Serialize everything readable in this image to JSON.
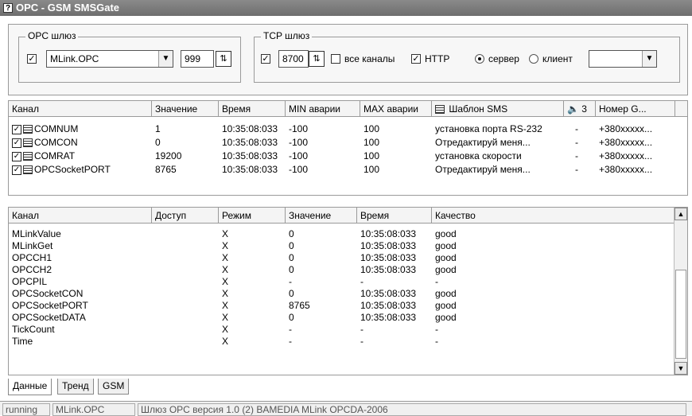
{
  "window": {
    "title": "OPC - GSM SMSGate",
    "title_icon": "?"
  },
  "opc_group": {
    "legend": "OPC шлюз",
    "server_value": "MLink.OPC",
    "port_value": "999"
  },
  "tcp_group": {
    "legend": "TCP шлюз",
    "port_value": "8700",
    "all_channels_label": "все каналы",
    "http_label": "HTTP",
    "server_label": "сервер",
    "client_label": "клиент",
    "mode_select_value": ""
  },
  "channels_table": {
    "columns": [
      "Канал",
      "Значение",
      "Время",
      "MIN аварии",
      "MAX аварии",
      "Шаблон SMS",
      "3",
      "Номер G..."
    ],
    "rows": [
      {
        "channel": "COMNUM",
        "value": "1",
        "time": "10:35:08:033",
        "min": "-100",
        "max": "100",
        "sms": "установка порта RS-232",
        "flag": "-",
        "phone": "+380xxxxx..."
      },
      {
        "channel": "COMCON",
        "value": "0",
        "time": "10:35:08:033",
        "min": "-100",
        "max": "100",
        "sms": "Отредактируй меня...",
        "flag": "-",
        "phone": "+380xxxxx..."
      },
      {
        "channel": "COMRAT",
        "value": "19200",
        "time": "10:35:08:033",
        "min": "-100",
        "max": "100",
        "sms": "установка скорости",
        "flag": "-",
        "phone": "+380xxxxx..."
      },
      {
        "channel": "OPCSocketPORT",
        "value": "8765",
        "time": "10:35:08:033",
        "min": "-100",
        "max": "100",
        "sms": "Отредактируй меня...",
        "flag": "-",
        "phone": "+380xxxxx..."
      }
    ]
  },
  "tags_table": {
    "columns": [
      "Канал",
      "Доступ",
      "Режим",
      "Значение",
      "Время",
      "Качество"
    ],
    "rows": [
      {
        "channel": "MLinkValue",
        "access": "",
        "mode": "X",
        "value": "0",
        "time": "10:35:08:033",
        "quality": "good"
      },
      {
        "channel": "MLinkGet",
        "access": "",
        "mode": "X",
        "value": "0",
        "time": "10:35:08:033",
        "quality": "good"
      },
      {
        "channel": "OPCCH1",
        "access": "",
        "mode": "X",
        "value": "0",
        "time": "10:35:08:033",
        "quality": "good"
      },
      {
        "channel": "OPCCH2",
        "access": "",
        "mode": "X",
        "value": "0",
        "time": "10:35:08:033",
        "quality": "good"
      },
      {
        "channel": "OPCPIL",
        "access": "",
        "mode": "X",
        "value": "-",
        "time": "-",
        "quality": "-"
      },
      {
        "channel": "OPCSocketCON",
        "access": "",
        "mode": "X",
        "value": "0",
        "time": "10:35:08:033",
        "quality": "good"
      },
      {
        "channel": "OPCSocketPORT",
        "access": "",
        "mode": "X",
        "value": "8765",
        "time": "10:35:08:033",
        "quality": "good"
      },
      {
        "channel": "OPCSocketDATA",
        "access": "",
        "mode": "X",
        "value": "0",
        "time": "10:35:08:033",
        "quality": "good"
      },
      {
        "channel": "TickCount",
        "access": "",
        "mode": "X",
        "value": "-",
        "time": "-",
        "quality": "-"
      },
      {
        "channel": "Time",
        "access": "",
        "mode": "X",
        "value": "-",
        "time": "-",
        "quality": "-"
      }
    ]
  },
  "tabs": [
    "Данные",
    "Тренд",
    "GSM"
  ],
  "status_bar": [
    "running",
    "MLink.OPC",
    "Шлюз OPC версия 1.0 (2) BAMEDIA MLink OPCDA-2006"
  ]
}
